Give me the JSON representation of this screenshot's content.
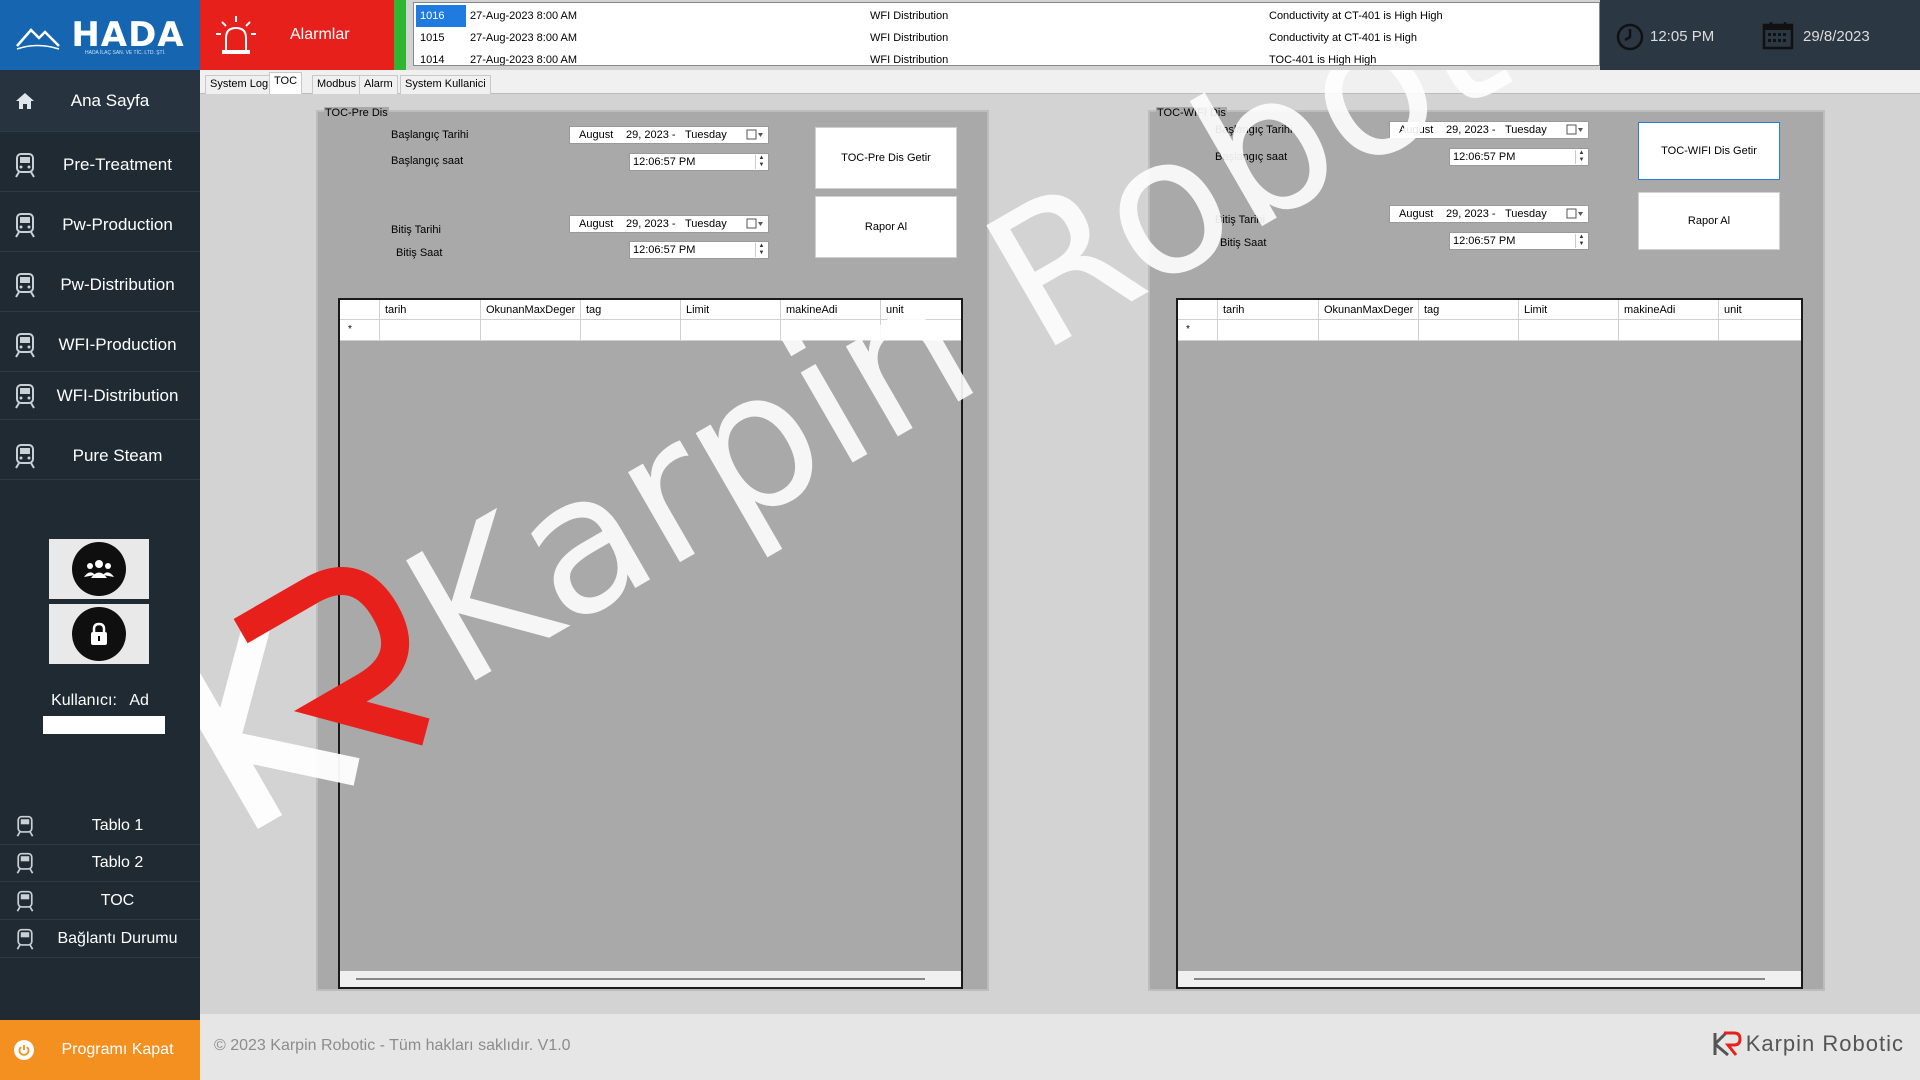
{
  "brand": {
    "logo_text": "HADA",
    "logo_sub": "HADA İLAÇ SAN. VE TİC. LTD. ŞTİ."
  },
  "sidebar": {
    "items": [
      {
        "label": "Ana Sayfa",
        "icon": "home-icon"
      },
      {
        "label": "Pre-Treatment",
        "icon": "train-icon"
      },
      {
        "label": "Pw-Production",
        "icon": "train-icon"
      },
      {
        "label": "Pw-Distribution",
        "icon": "train-icon"
      },
      {
        "label": "WFI-Production",
        "icon": "train-icon"
      },
      {
        "label": "WFI-Distribution",
        "icon": "train-icon"
      },
      {
        "label": "Pure Steam",
        "icon": "train-icon"
      }
    ],
    "bottom_items": [
      {
        "label": "Tablo 1"
      },
      {
        "label": "Tablo 2"
      },
      {
        "label": "TOC"
      },
      {
        "label": "Bağlantı Durumu"
      }
    ],
    "user_label": "Kullanıcı:",
    "user_name": "Ad",
    "exit_label": "Programı Kapat"
  },
  "alarm": {
    "label": "Alarmlar",
    "rows": [
      {
        "id": "1016",
        "datetime": "27-Aug-2023 8:00 AM",
        "source": "WFI Distribution",
        "message": "Conductivity at CT-401 is High High"
      },
      {
        "id": "1015",
        "datetime": "27-Aug-2023 8:00 AM",
        "source": "WFI Distribution",
        "message": "Conductivity at CT-401 is High"
      },
      {
        "id": "1014",
        "datetime": "27-Aug-2023 8:00 AM",
        "source": "WFI Distribution",
        "message": "TOC-401 is High High"
      }
    ]
  },
  "clock": {
    "time": "12:05 PM",
    "date": "29/8/2023"
  },
  "tabs": [
    "System Log",
    "TOC",
    "Modbus",
    "Alarm",
    "System Kullanici"
  ],
  "panels": {
    "left": {
      "title": "TOC-Pre Dis",
      "start_date_label": "Başlangıç Tarihi",
      "start_time_label": "Başlangıç saat",
      "end_date_label": "Bitiş Tarihi",
      "end_time_label": "Bitiş Saat",
      "date_month": "August",
      "date_day": "29, 2023 -",
      "date_weekday": "Tuesday",
      "time_value": "12:06:57 PM",
      "fetch_button": "TOC-Pre Dis Getir",
      "report_button": "Rapor Al"
    },
    "right": {
      "title": "TOC-WIFI Dis",
      "start_date_label": "Başlangıç Tarihi",
      "start_time_label": "Başlangıç saat",
      "end_date_label": "Bitiş Tarihi",
      "end_time_label": "Bitiş Saat",
      "date_month": "August",
      "date_day": "29, 2023 -",
      "date_weekday": "Tuesday",
      "time_value": "12:06:57 PM",
      "fetch_button": "TOC-WIFI Dis Getir",
      "report_button": "Rapor Al"
    },
    "columns": [
      "tarih",
      "OkunanMaxDeger",
      "tag",
      "Limit",
      "makineAdi",
      "unit"
    ],
    "new_row_marker": "*"
  },
  "footer": {
    "copyright": "© 2023 Karpin Robotic - Tüm hakları saklıdır. V1.0",
    "brand": "Karpin Robotic"
  },
  "watermark": {
    "text": "Karpin Robotic"
  },
  "colors": {
    "logo_bg": "#1565b0",
    "sidebar_bg": "#1f2a33",
    "alarm_red": "#e8201c",
    "alarm_green": "#2fb52f",
    "exit_orange": "#f39020",
    "selected_blue": "#1f7be0"
  }
}
